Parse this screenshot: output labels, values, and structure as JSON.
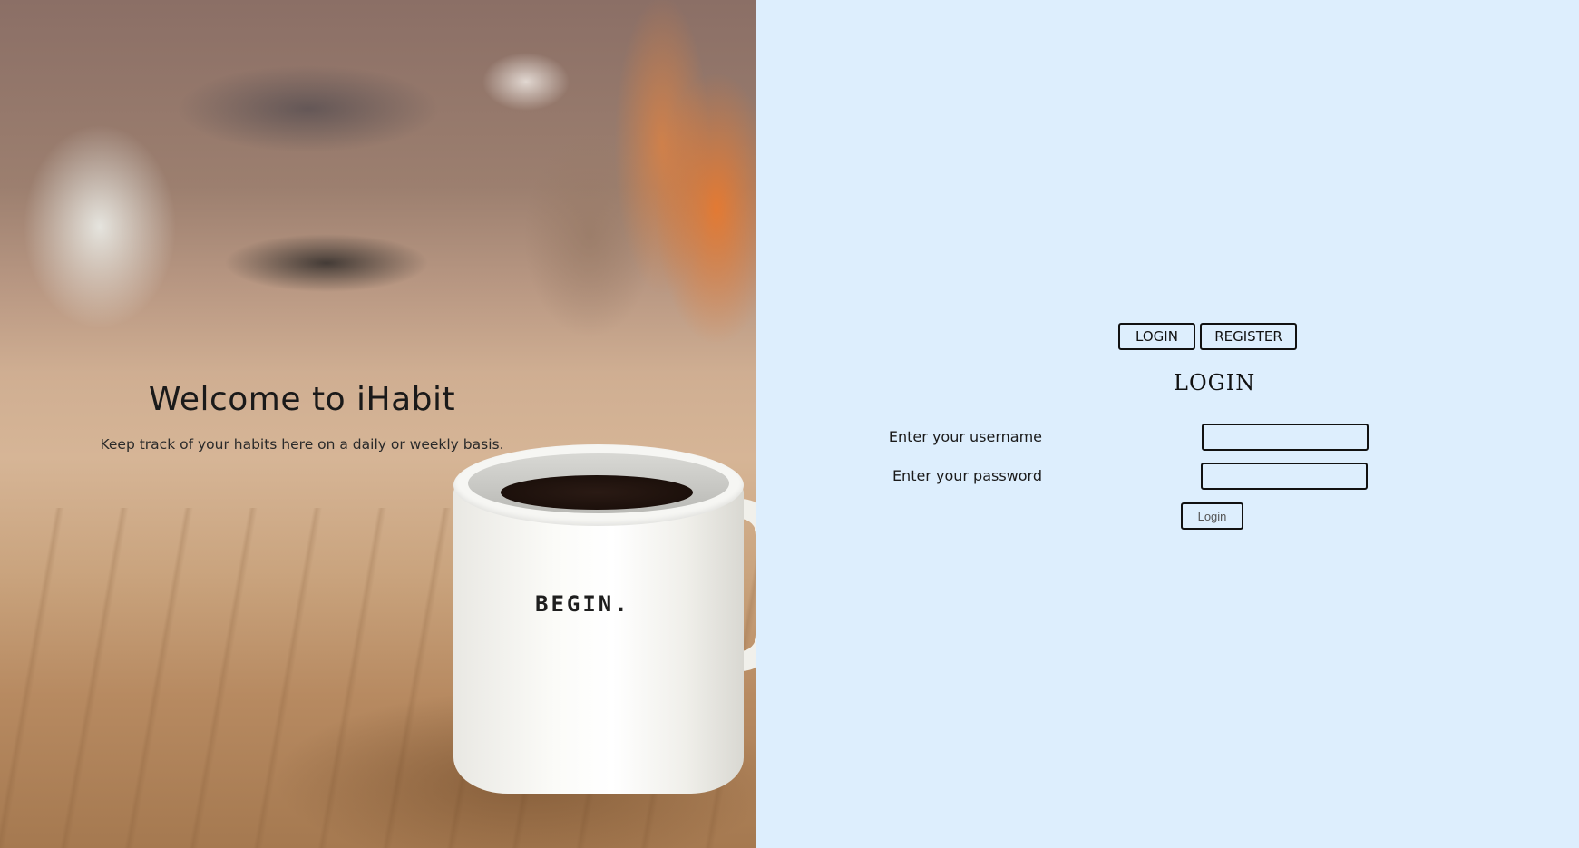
{
  "hero": {
    "title": "Welcome to iHabit",
    "subtitle": "Keep track of your habits here on a daily or weekly basis.",
    "mug_text": "BEGIN."
  },
  "auth": {
    "tabs": {
      "login_label": "LOGIN",
      "register_label": "REGISTER"
    },
    "form_title": "LOGIN",
    "username": {
      "label": "Enter your username",
      "value": ""
    },
    "password": {
      "label": "Enter your password",
      "value": ""
    },
    "submit_label": "Login"
  },
  "colors": {
    "panel_background": "#ddeefd",
    "border": "#111111",
    "text": "#1a1a1a"
  }
}
